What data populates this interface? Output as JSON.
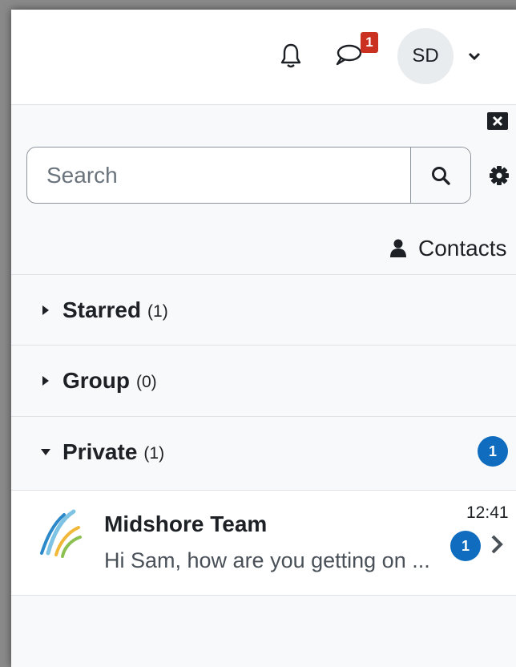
{
  "header": {
    "notification_count": "1",
    "avatar_initials": "SD"
  },
  "drawer": {
    "search": {
      "placeholder": "Search",
      "value": ""
    },
    "contacts_label": "Contacts",
    "sections": [
      {
        "label": "Starred",
        "count": "(1)",
        "expanded": false
      },
      {
        "label": "Group",
        "count": "(0)",
        "expanded": false
      },
      {
        "label": "Private",
        "count": "(1)",
        "expanded": true,
        "unread": "1"
      }
    ],
    "conversation": {
      "name": "Midshore Team",
      "snippet": "Hi Sam, how are you getting on ...",
      "time": "12:41",
      "unread": "1"
    }
  },
  "colors": {
    "badge_red": "#ca3120",
    "badge_blue": "#0f6cbf",
    "panel_bg": "#f8f9fa"
  },
  "icons": [
    "bell-icon",
    "chat-icon",
    "chevron-down-icon",
    "close-icon",
    "search-icon",
    "gear-icon",
    "user-icon",
    "caret-right-icon",
    "caret-down-icon",
    "chevron-right-icon",
    "midshore-logo"
  ]
}
